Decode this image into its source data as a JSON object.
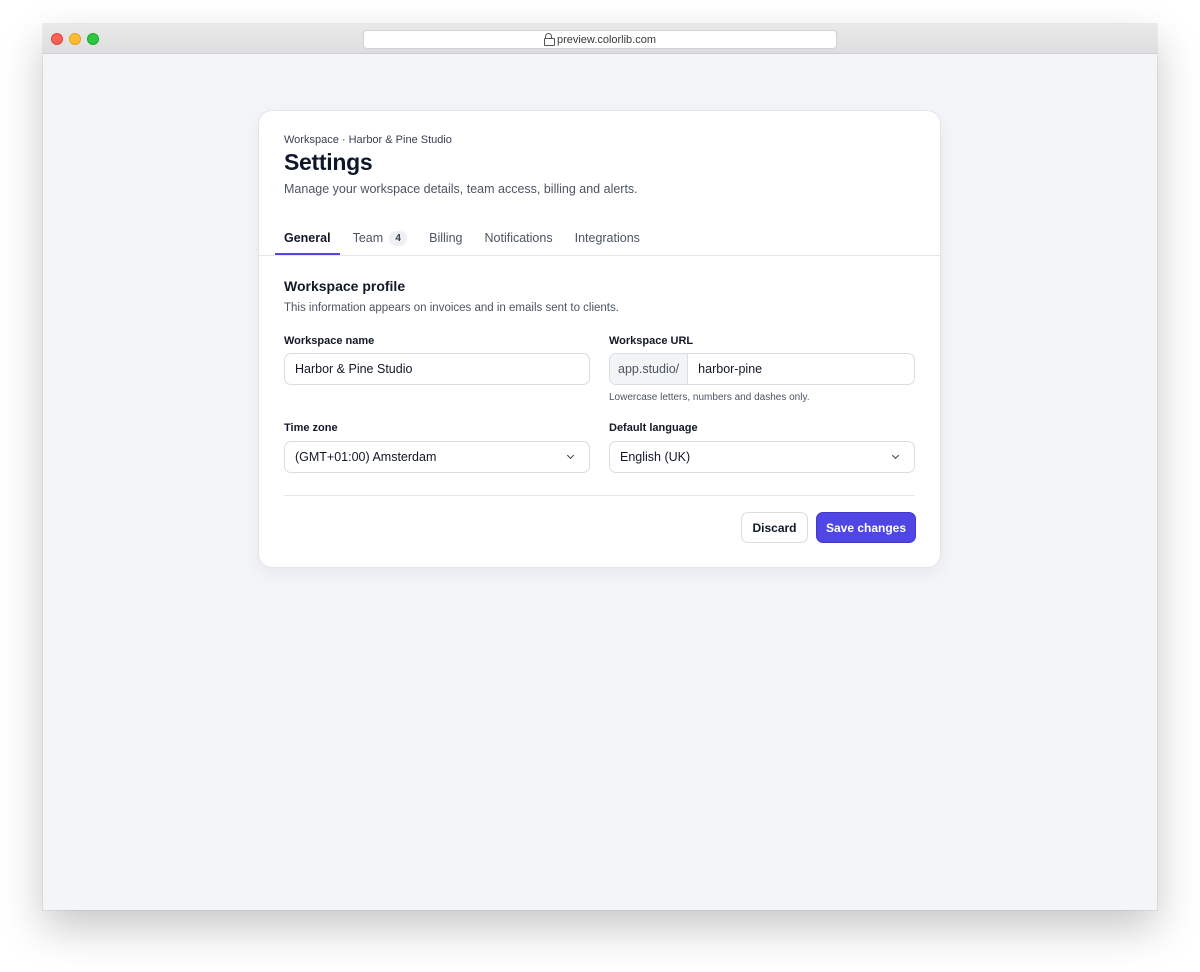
{
  "browser": {
    "url": "preview.colorlib.com"
  },
  "page": {
    "breadcrumb": "Workspace · Harbor & Pine Studio",
    "title": "Settings",
    "subtitle": "Manage your workspace details, team access, billing and alerts."
  },
  "tabs": [
    {
      "label": "General",
      "active": true
    },
    {
      "label": "Team",
      "badge": "4"
    },
    {
      "label": "Billing"
    },
    {
      "label": "Notifications"
    },
    {
      "label": "Integrations"
    }
  ],
  "profile": {
    "title": "Workspace profile",
    "description": "This information appears on invoices and in emails sent to clients.",
    "workspace_name": {
      "label": "Workspace name",
      "value": "Harbor & Pine Studio"
    },
    "workspace_url": {
      "label": "Workspace URL",
      "prefix": "app.studio/",
      "value": "harbor-pine",
      "hint": "Lowercase letters, numbers and dashes only."
    },
    "time_zone": {
      "label": "Time zone",
      "value": "(GMT+01:00) Amsterdam"
    },
    "language": {
      "label": "Default language",
      "value": "English (UK)"
    }
  },
  "actions": {
    "discard": "Discard",
    "save": "Save changes"
  },
  "colors": {
    "accent": "#4f46e5",
    "background": "#f4f5f9"
  }
}
